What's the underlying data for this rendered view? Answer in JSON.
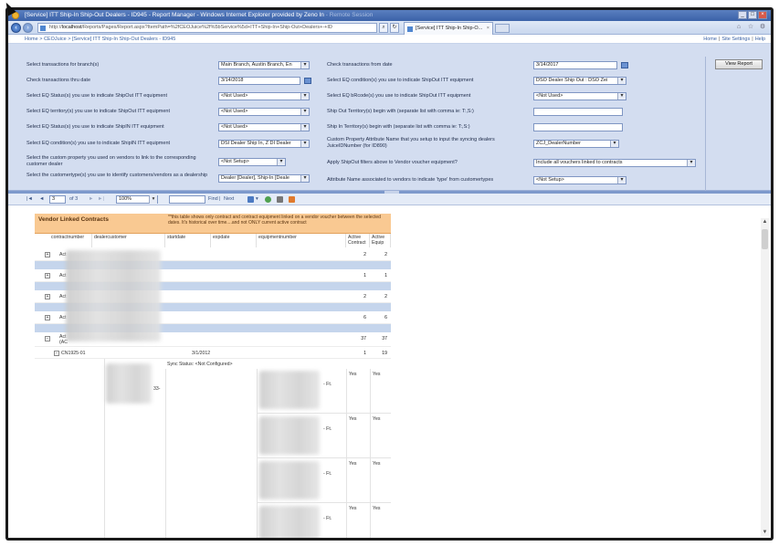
{
  "window": {
    "title": "[Service] ITT Ship-In Ship-Out Dealers - ID945 - Report Manager - Windows Internet Explorer provided by Zeno In",
    "ghost_title": "- Remote Session"
  },
  "browser": {
    "url_prefix": "http://",
    "url_host": "localhost",
    "url_rest": "/Reports/Pages/Report.aspx?ItemPath=%2fCEOJuice%2f%5bService%5d+ITT+Ship-In+Ship-Out+Dealers+-+ID",
    "tab_label": "[Service] ITT Ship-In Ship-O...",
    "tab_close": "×"
  },
  "breadcrumb": {
    "text": "Home > CEOJuice > [Service] ITT Ship-In Ship-Out Dealers - ID945",
    "links": [
      "Home",
      "Site Settings",
      "Help"
    ]
  },
  "params": {
    "view_report": "View Report",
    "left": [
      {
        "label": "Select transactions for branch(s)",
        "value": "Main Branch, Austin Branch, En"
      },
      {
        "label": "Check transactions thru date",
        "value": "3/14/2018"
      },
      {
        "label": "Select EQ Status(s) you use to indicate ShipOut ITT equipment",
        "value": "<Not Used>"
      },
      {
        "label": "Select EQ territory(s) you use to indicate ShipOut ITT equipment",
        "value": "<Not Used>"
      },
      {
        "label": "Select EQ Status(s) you use to indicate ShipIN ITT equipment",
        "value": "<Not Used>"
      },
      {
        "label": "Select EQ condition(s) you use to indicate ShipIN ITT equipment",
        "value": "DSI Dealer Ship In, Z DI Dealer"
      },
      {
        "label": "Select the custom property you used on vendors to link to the corresponding customer dealer",
        "value": "<Not Setup>"
      },
      {
        "label": "Select the customertype(s) you use to identify customers/vendors as a dealership",
        "value": "Dealer [Dealer], Ship-In [Deale"
      }
    ],
    "right": [
      {
        "label": "Check transactions from date",
        "value": "3/14/2017"
      },
      {
        "label": "Select EQ condition(s) you use to indicate ShipOut ITT equipment",
        "value": "DSO Dealer Ship Out : DSO Zei"
      },
      {
        "label": "Select EQ bRcode(s) you use to indicate ShipOut ITT equipment",
        "value": "<Not Used>"
      },
      {
        "label": "Ship Out Territory(s) begin with (separate list with comma ie: T:,S:)",
        "value": ""
      },
      {
        "label": "Ship In Territory(s) begin with (separate list with comma ie: T:,S:)",
        "value": ""
      },
      {
        "label": "Custom Property Attribute Name that you setup to input the syncing dealers JuiceIDNumber (for ID890)",
        "value": "ZCJ_DealerNumber"
      },
      {
        "label": "Apply ShipOut filters above to Vendor voucher equipment?",
        "value": "Include all vouchers linked to contracts"
      },
      {
        "label": "Attribute Name associated to vendors to indicate 'type' from customertypes",
        "value": "<Not Setup>"
      }
    ]
  },
  "toolbar": {
    "page_current": "3",
    "page_of": "of 3",
    "zoom": "100%",
    "find_label": "Find",
    "next_label": "Next",
    "find_sep": "|"
  },
  "report": {
    "title": "Vendor Linked Contracts",
    "note": "**this table shows only contract and contract equipment linked on a vendor voucher between the selected dates. It's historical over time....and not ONLY current active contract",
    "columns": [
      "contractnumber",
      "dealercustomer",
      "startdate",
      "expdate",
      "equipmentnumber",
      "Active Contract",
      "Active Equip"
    ],
    "rows": [
      {
        "cn": "Act",
        "ac": "2",
        "ae": "2"
      },
      {
        "cn": "Act",
        "ac": "1",
        "ae": "1"
      },
      {
        "cn": "Act",
        "ac": "2",
        "ae": "2"
      },
      {
        "cn": "Act",
        "ac": "6",
        "ae": "6"
      },
      {
        "cn": "Act",
        "cn2": "(AC",
        "ac": "37",
        "ae": "37"
      }
    ],
    "detail": {
      "contract": "CN1925-01",
      "startdate": "3/1/2012",
      "ac": "1",
      "ae": "19",
      "sync_status": "Sync Status: <Not Configured>",
      "dealer_fragment": "33-",
      "ft_label": "- Ft.",
      "yes": "Yes"
    }
  },
  "icons": {
    "first": "first-page-icon",
    "prev": "prev-page-icon",
    "next": "next-page-icon",
    "last": "last-page-icon"
  },
  "colors": {
    "param_bg": "#d3ddf0",
    "header_orange": "#f9c992",
    "band_blue": "#c5d5ec"
  }
}
